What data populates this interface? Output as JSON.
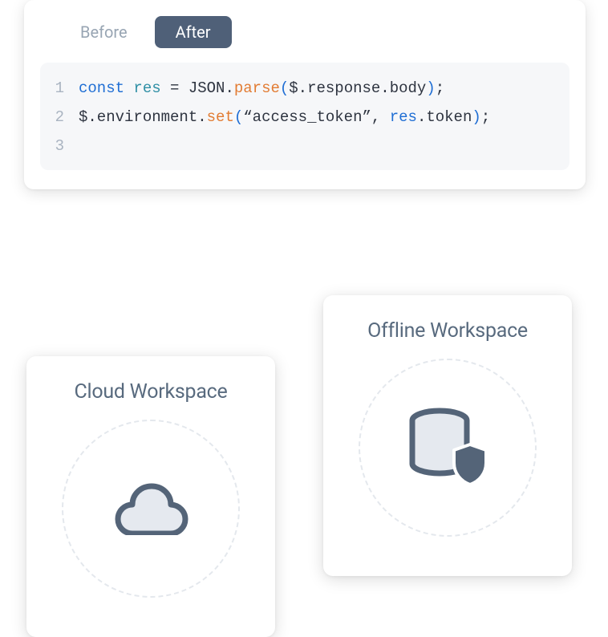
{
  "tabs": {
    "before": "Before",
    "after": "After"
  },
  "code": {
    "lines": [
      {
        "num": "1",
        "tokens": [
          {
            "cls": "tok-keyword",
            "t": "const "
          },
          {
            "cls": "tok-var",
            "t": "res"
          },
          {
            "cls": "tok-plain",
            "t": " = JSON."
          },
          {
            "cls": "tok-func",
            "t": "parse"
          },
          {
            "cls": "tok-paren",
            "t": "("
          },
          {
            "cls": "tok-plain",
            "t": "$.response.body"
          },
          {
            "cls": "tok-paren",
            "t": ")"
          },
          {
            "cls": "tok-plain",
            "t": ";"
          }
        ]
      },
      {
        "num": "2",
        "tokens": [
          {
            "cls": "tok-plain",
            "t": "$.environment."
          },
          {
            "cls": "tok-func",
            "t": "set"
          },
          {
            "cls": "tok-paren",
            "t": "("
          },
          {
            "cls": "tok-str",
            "t": "“access_token”"
          },
          {
            "cls": "tok-plain",
            "t": ", "
          },
          {
            "cls": "tok-arg",
            "t": "res"
          },
          {
            "cls": "tok-plain",
            "t": ".token"
          },
          {
            "cls": "tok-paren",
            "t": ")"
          },
          {
            "cls": "tok-plain",
            "t": ";"
          }
        ]
      },
      {
        "num": "3",
        "tokens": []
      }
    ]
  },
  "workspaces": {
    "cloud": {
      "title": "Cloud Workspace"
    },
    "offline": {
      "title": "Offline Workspace"
    }
  }
}
